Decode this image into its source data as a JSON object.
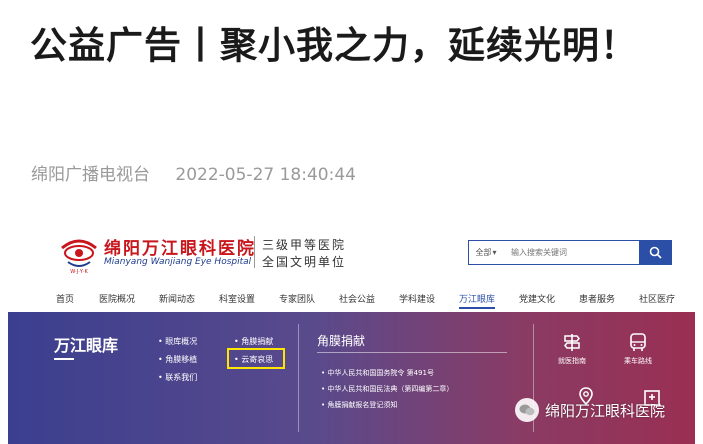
{
  "article": {
    "title": "公益广告丨聚小我之力，延续光明！",
    "source": "绵阳广播电视台",
    "datetime": "2022-05-27 18:40:44"
  },
  "site": {
    "logo_cn": "绵阳万江眼科医院",
    "logo_en": "Mianyang Wanjiang Eye Hospital",
    "rank_line1": "三级甲等医院",
    "rank_line2": "全国文明单位",
    "search": {
      "select_label": "全部",
      "placeholder": "输入搜索关键词"
    },
    "nav": [
      "首页",
      "医院概况",
      "新闻动态",
      "科室设置",
      "专家团队",
      "社会公益",
      "学科建设",
      "万江眼库",
      "党建文化",
      "患者服务",
      "社区医疗"
    ],
    "nav_active": "万江眼库",
    "panel": {
      "title": "万江眼库",
      "links_col1": [
        "眼库概况",
        "角膜移植",
        "联系我们"
      ],
      "links_col2": [
        "角膜捐献",
        "云寄哀思"
      ],
      "section_title": "角膜捐献",
      "news": [
        "中华人民共和国国务院令 第491号",
        "中华人民共和国民法典（第四编第二章）",
        "角膜捐献报名登记须知"
      ],
      "services": [
        "就医指南",
        "乘车路线"
      ]
    }
  },
  "watermark": "绵阳万江眼科医院",
  "colors": {
    "brand_red": "#c8161d",
    "brand_blue": "#2b4fa6",
    "highlight": "#ffe600"
  }
}
